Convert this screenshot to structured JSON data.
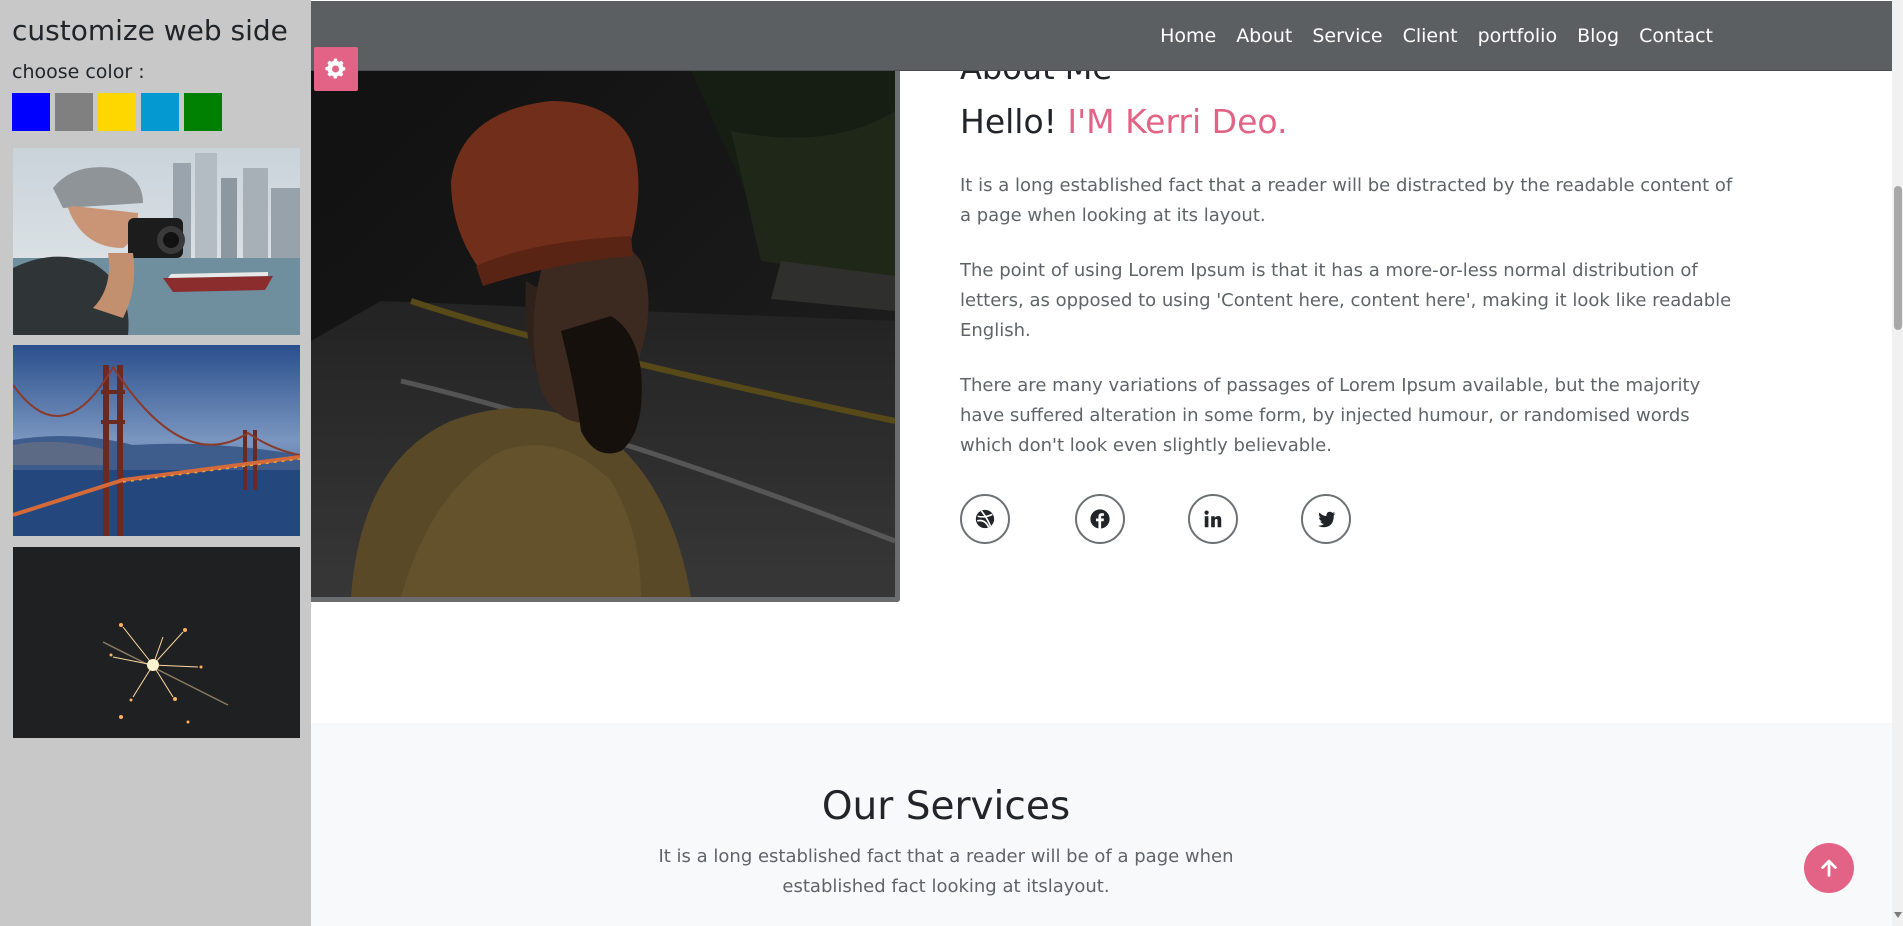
{
  "customize": {
    "title": "customize web side",
    "color_label": "choose color :",
    "colors": [
      "#0000ff",
      "#808080",
      "#ffd700",
      "#0499d0",
      "#008000"
    ],
    "thumbnails": [
      "photographer-city-image",
      "golden-gate-bridge-image",
      "sparkler-image"
    ]
  },
  "nav": {
    "items": [
      {
        "label": "Home"
      },
      {
        "label": "About"
      },
      {
        "label": "Service"
      },
      {
        "label": "Client"
      },
      {
        "label": "portfolio"
      },
      {
        "label": "Blog"
      },
      {
        "label": "Contact"
      }
    ]
  },
  "about": {
    "title": "About Me",
    "hello": "Hello!",
    "name": "I'M Kerri Deo.",
    "paragraphs": [
      "It is a long established fact that a reader will be distracted by the readable content of a page when looking at its layout.",
      "The point of using Lorem Ipsum is that it has a more-or-less normal distribution of letters, as opposed to using 'Content here, content here', making it look like readable English.",
      "There are many variations of passages of Lorem Ipsum available, but the majority have suffered alteration in some form, by injected humour, or randomised words which don't look even slightly believable."
    ],
    "social": [
      "dribbble-icon",
      "facebook-icon",
      "linkedin-icon",
      "twitter-icon"
    ]
  },
  "services": {
    "title": "Our Services",
    "subtitle": "It is a long established fact that a reader will be of a page when established fact looking at itslayout."
  },
  "theme": {
    "accent": "#e36386",
    "navbar": "#5c5f62",
    "panel": "#c8c8c8"
  }
}
